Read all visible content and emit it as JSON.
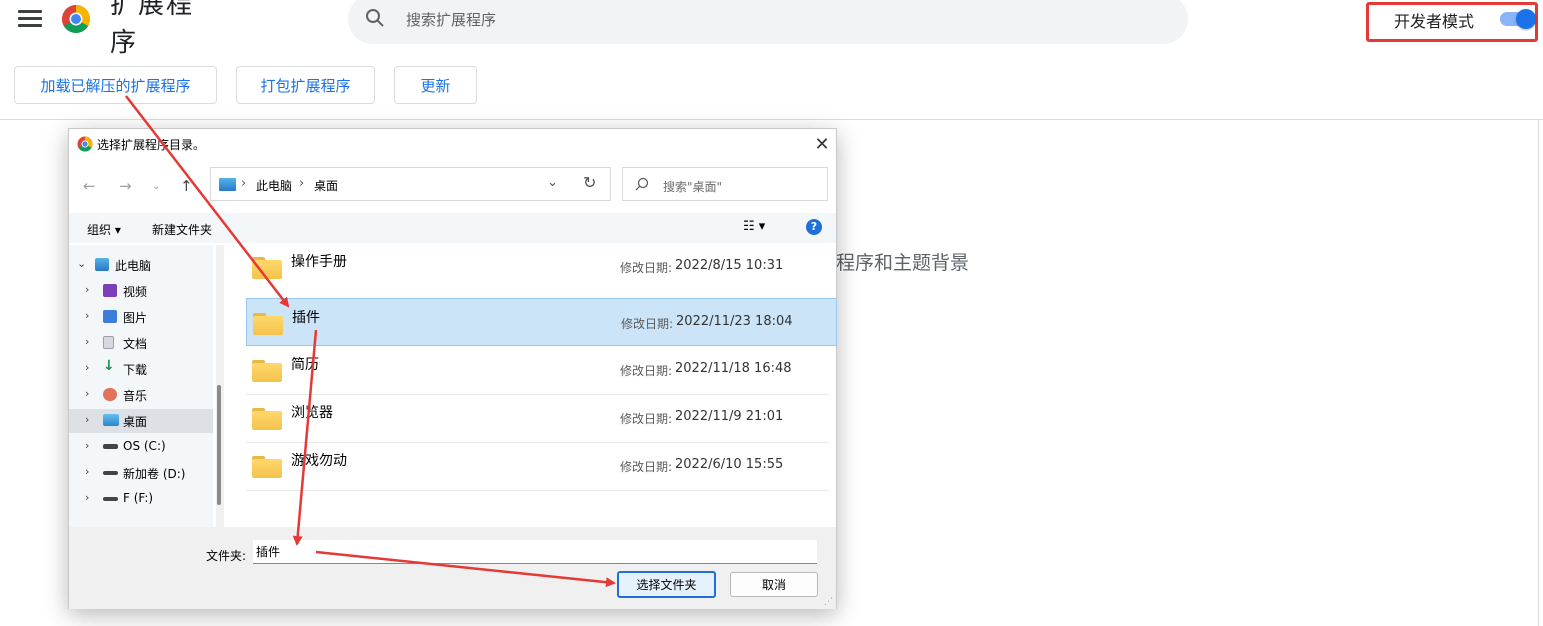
{
  "app": {
    "page_title": "扩展程序",
    "search_placeholder": "搜索扩展程序",
    "dev_mode_label": "开发者模式",
    "dev_mode_on": true,
    "buttons": {
      "load_unpacked": "加载已解压的扩展程序",
      "pack": "打包扩展程序",
      "update": "更新"
    },
    "background_text": "程序和主题背景"
  },
  "dialog": {
    "title": "选择扩展程序目录。",
    "address": {
      "root": "此电脑",
      "current": "桌面"
    },
    "search_placeholder": "搜索\"桌面\"",
    "toolbar": {
      "organize": "组织 ▾",
      "new_folder": "新建文件夹"
    },
    "tree": [
      {
        "label": "此电脑",
        "icon": "computer-icon"
      },
      {
        "label": "视频",
        "icon": "video-icon"
      },
      {
        "label": "图片",
        "icon": "picture-icon"
      },
      {
        "label": "文档",
        "icon": "document-icon"
      },
      {
        "label": "下载",
        "icon": "download-icon"
      },
      {
        "label": "音乐",
        "icon": "music-icon"
      },
      {
        "label": "桌面",
        "icon": "desktop-icon"
      },
      {
        "label": "OS (C:)",
        "icon": "drive-icon"
      },
      {
        "label": "新加卷 (D:)",
        "icon": "drive-icon"
      },
      {
        "label": "F (F:)",
        "icon": "drive-icon"
      }
    ],
    "date_label": "修改日期:",
    "files": [
      {
        "name": "操作手册",
        "date": "2022/8/15 10:31"
      },
      {
        "name": "插件",
        "date": "2022/11/23 18:04",
        "selected": true
      },
      {
        "name": "简历",
        "date": "2022/11/18 16:48"
      },
      {
        "name": "浏览器",
        "date": "2022/11/9 21:01"
      },
      {
        "name": "游戏勿动",
        "date": "2022/6/10 15:55"
      }
    ],
    "folder_label": "文件夹:",
    "folder_value": "插件",
    "ok_label": "选择文件夹",
    "cancel_label": "取消"
  },
  "colors": {
    "annotation_red": "#e53935",
    "chrome_blue": "#1a73e8",
    "selection": "#cce4f7"
  }
}
